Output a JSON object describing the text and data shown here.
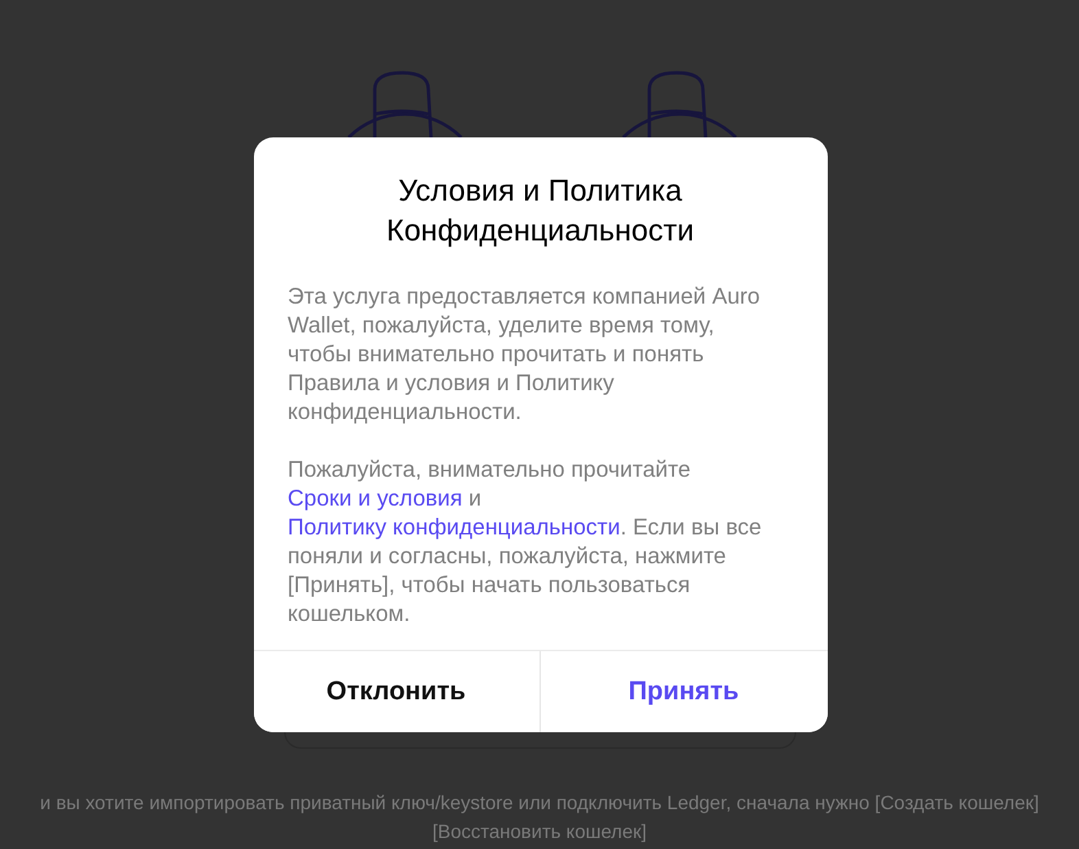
{
  "dialog": {
    "title": "Условия и Политика Конфиденциальности",
    "paragraphs": [
      {
        "parts": [
          {
            "kind": "text",
            "text": "Эта услуга предоставляется компанией Auro Wallet, пожалуйста, уделите время тому, чтобы внимательно прочитать и понять Правила и условия и Политику конфиденциальности."
          }
        ]
      },
      {
        "parts": [
          {
            "kind": "text",
            "text": "Пожалуйста, внимательно прочитайте "
          },
          {
            "kind": "link",
            "text": "Сроки и условия"
          },
          {
            "kind": "text",
            "text": " и "
          },
          {
            "kind": "link",
            "text": "Политику конфиденциальности"
          },
          {
            "kind": "text",
            "text": ". Если вы все поняли и согласны, пожалуйста, нажмите [Принять], чтобы начать пользоваться кошельком."
          }
        ]
      }
    ],
    "buttons": [
      {
        "kind": "secondary",
        "label": "Отклонить"
      },
      {
        "kind": "primary",
        "label": "Принять"
      }
    ]
  },
  "footer_note": {
    "lines": [
      "и вы хотите импортировать приватный ключ/keystore или подключить Ledger, сначала нужно [Создать кошелек]",
      "[Восстановить кошелек]"
    ]
  }
}
